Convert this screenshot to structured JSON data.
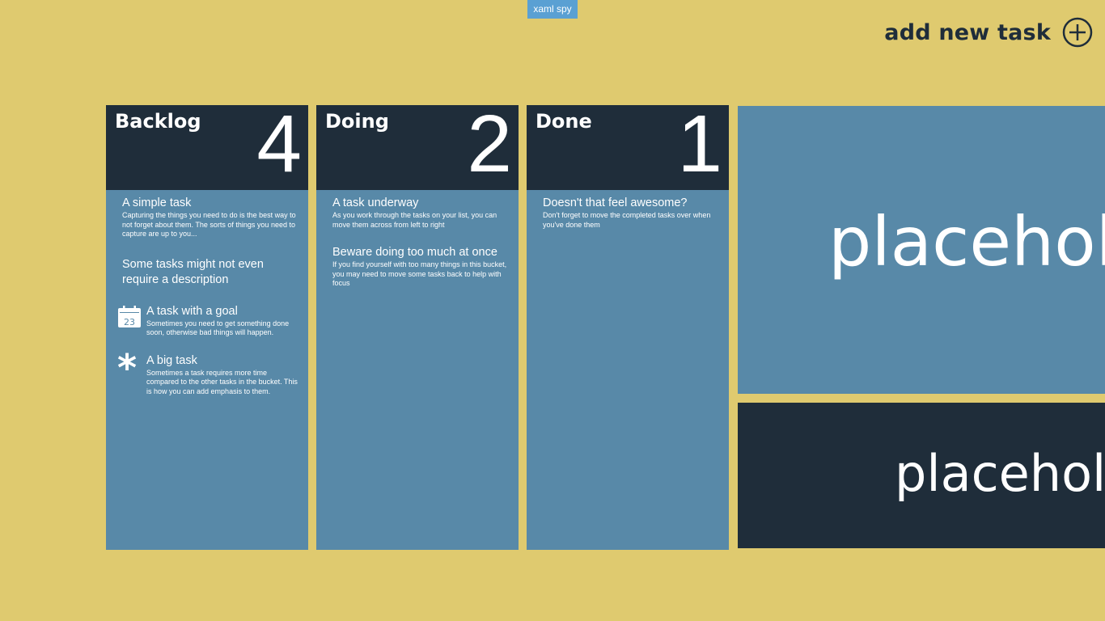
{
  "toolbar": {
    "xaml_spy_label": "xaml spy",
    "add_task_label": "add new task"
  },
  "buckets": [
    {
      "title": "Backlog",
      "count": "4",
      "tasks": [
        {
          "title": "A simple task",
          "description": "Capturing the things you need to do is the best way to not forget about them. The sorts of things you need to capture are up to you..."
        },
        {
          "title": "Some tasks might not even require a description",
          "description": ""
        },
        {
          "title": "A task with a goal",
          "description": "Sometimes you need to get something done soon, otherwise bad things will happen.",
          "icon": "calendar-icon",
          "icon_text": "23"
        },
        {
          "title": "A big task",
          "description": "Sometimes a task requires more time compared to the other tasks in the bucket. This is how you can add emphasis to them.",
          "icon": "asterisk-icon",
          "icon_text": "*"
        }
      ]
    },
    {
      "title": "Doing",
      "count": "2",
      "tasks": [
        {
          "title": "A task underway",
          "description": "As you work through the tasks on your list, you can move them across from left to right"
        },
        {
          "title": "Beware doing too much at once",
          "description": "If you find yourself with too many things in this bucket, you may need to move some tasks back to help with focus"
        }
      ]
    },
    {
      "title": "Done",
      "count": "1",
      "tasks": [
        {
          "title": "Doesn't that feel awesome?",
          "description": "Don't forget to move the completed tasks over when you've done them"
        }
      ]
    }
  ],
  "placeholders": {
    "top_text": "placeholder",
    "bottom_text": "placeholder"
  },
  "colors": {
    "background": "#dfca6f",
    "tile_blue": "#5889a8",
    "tile_dark": "#1f2d3a",
    "xaml_spy_blue": "#5aa0d3"
  }
}
